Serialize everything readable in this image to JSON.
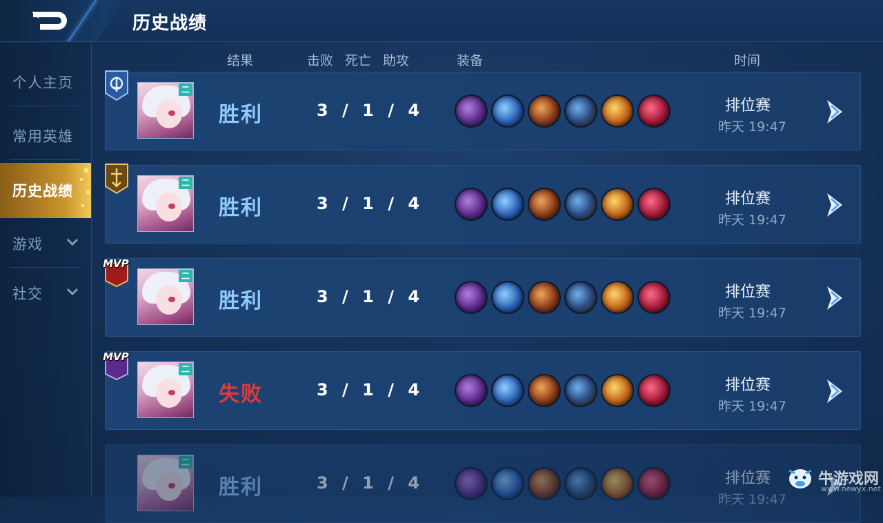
{
  "header": {
    "title": "历史战绩",
    "back_icon": "back-arrow-icon"
  },
  "sidebar": {
    "items": [
      {
        "label": "个人主页",
        "active": false
      },
      {
        "label": "常用英雄",
        "active": false
      },
      {
        "label": "历史战绩",
        "active": true
      },
      {
        "label": "游戏",
        "active": false,
        "expandable": true
      },
      {
        "label": "社交",
        "active": false,
        "expandable": true
      }
    ]
  },
  "columns": {
    "result": "结果",
    "kills": "击败",
    "deaths": "死亡",
    "assists": "助攻",
    "equipment": "装备",
    "time": "时间"
  },
  "matches": [
    {
      "badge": "rank-badge-icon",
      "avatar_tag": "二",
      "result": "胜利",
      "outcome": "win",
      "kda": "3 / 1 / 4",
      "mode": "排位赛",
      "time": "昨天 19:47"
    },
    {
      "badge": "rank-badge-gold-icon",
      "avatar_tag": "二",
      "result": "胜利",
      "outcome": "win",
      "kda": "3 / 1 / 4",
      "mode": "排位赛",
      "time": "昨天 19:47"
    },
    {
      "badge": "mvp-red-icon",
      "badge_text": "MVP",
      "avatar_tag": "二",
      "result": "胜利",
      "outcome": "win",
      "kda": "3 / 1 / 4",
      "mode": "排位赛",
      "time": "昨天 19:47"
    },
    {
      "badge": "mvp-purple-icon",
      "badge_text": "MVP",
      "avatar_tag": "二",
      "result": "失败",
      "outcome": "lose",
      "kda": "3 / 1 / 4",
      "mode": "排位赛",
      "time": "昨天 19:47"
    },
    {
      "badge": "",
      "avatar_tag": "二",
      "result": "胜利",
      "outcome": "win",
      "kda": "3 / 1 / 4",
      "mode": "排位赛",
      "time": "昨天 19:47"
    }
  ],
  "equipment_icons": [
    "axe-item-icon",
    "blue-blade-item-icon",
    "red-sword-item-icon",
    "cross-shield-item-icon",
    "flame-wing-item-icon",
    "crimson-mask-item-icon"
  ],
  "colors": {
    "win": "#8fcaff",
    "lose": "#e03a3a",
    "active_tab": "#c9932c"
  },
  "watermark": {
    "text": "牛游戏网",
    "url": "www.newyx.net"
  }
}
